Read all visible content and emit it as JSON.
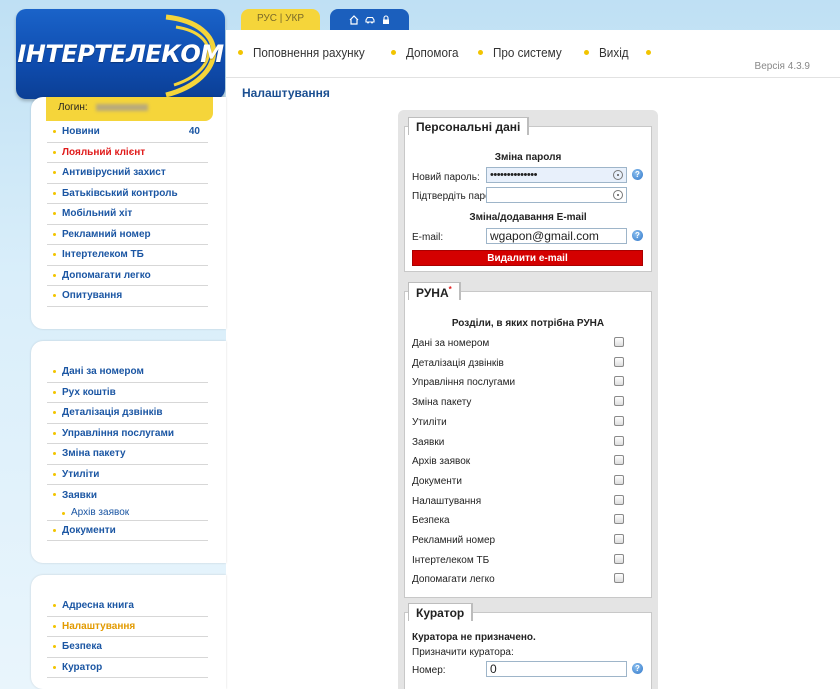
{
  "logo": {
    "text": "ІНТЕРТЕЛЕКОМ"
  },
  "lang": {
    "ru": "РУС",
    "sep": "|",
    "uk": "УКР"
  },
  "icons": [
    "home-icon",
    "car-icon",
    "lock-icon"
  ],
  "nav": {
    "items": [
      "Поповнення рахунку",
      "Допомога",
      "Про систему",
      "Вихід"
    ],
    "version": "Версія 4.3.9"
  },
  "page": {
    "title": "Налаштування"
  },
  "login": {
    "label": "Логин:"
  },
  "sidebar": {
    "group1": [
      {
        "label": "Новини",
        "count": "40"
      },
      {
        "label": "Лояльний клієнт"
      },
      {
        "label": "Антивірусний захист"
      },
      {
        "label": "Батьківський контроль"
      },
      {
        "label": "Мобільний хіт"
      },
      {
        "label": "Рекламний номер"
      },
      {
        "label": "Інтертелеком ТБ"
      },
      {
        "label": "Допомагати легко"
      },
      {
        "label": "Опитування"
      }
    ],
    "group2": [
      {
        "label": "Дані за номером"
      },
      {
        "label": "Рух коштів"
      },
      {
        "label": "Деталізація дзвінків"
      },
      {
        "label": "Управління послугами"
      },
      {
        "label": "Зміна пакету"
      },
      {
        "label": "Утиліти"
      },
      {
        "label": "Заявки"
      },
      {
        "label": "Архів заявок"
      },
      {
        "label": "Документи"
      }
    ],
    "group3": [
      {
        "label": "Адресна книга"
      },
      {
        "label": "Налаштування"
      },
      {
        "label": "Безпека"
      },
      {
        "label": "Куратор"
      }
    ]
  },
  "personal": {
    "title": "Персональні дані",
    "password_heading": "Зміна пароля",
    "new_password_label": "Новий пароль:",
    "new_password_value": "••••••••••••••",
    "confirm_password_label": "Підтвердіть пароль:",
    "confirm_password_value": "",
    "email_heading": "Зміна/додавання E-mail",
    "email_label": "E-mail:",
    "email_value": "wgapon@gmail.com",
    "delete_email_button": "Видалити e-mail"
  },
  "runa": {
    "title": "РУНА",
    "required_mark": "*",
    "heading": "Розділи, в яких потрібна РУНА",
    "items": [
      {
        "label": "Дані за номером",
        "checked": false
      },
      {
        "label": "Деталізація дзвінків",
        "checked": false
      },
      {
        "label": "Управління послугами",
        "checked": false
      },
      {
        "label": "Зміна пакету",
        "checked": false
      },
      {
        "label": "Утиліти",
        "checked": false
      },
      {
        "label": "Заявки",
        "checked": false
      },
      {
        "label": "Архів заявок",
        "checked": false
      },
      {
        "label": "Документи",
        "checked": false
      },
      {
        "label": "Налаштування",
        "checked": false
      },
      {
        "label": "Безпека",
        "checked": false
      },
      {
        "label": "Рекламний номер",
        "checked": false
      },
      {
        "label": "Інтертелеком ТБ",
        "checked": false
      },
      {
        "label": "Допомагати легко",
        "checked": false
      }
    ]
  },
  "curator": {
    "title": "Куратор",
    "status": "Куратора не призначено.",
    "assign_label": "Призначити куратора:",
    "number_label": "Номер:",
    "number_value": "0"
  },
  "colors": {
    "brand_blue": "#1b5fbd",
    "accent_yellow": "#f5d53a",
    "danger_red": "#d40000",
    "link_blue": "#1b56a3"
  }
}
